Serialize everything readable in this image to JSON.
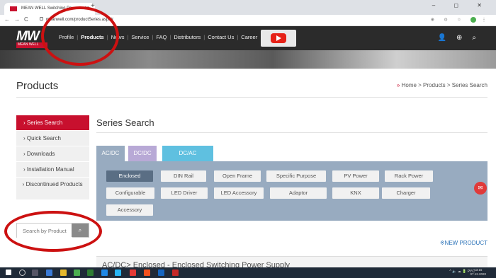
{
  "browser": {
    "tab_title": "MEAN WELL Switching Po...",
    "url": "meanwell.com/productSeries.aspx#",
    "win_controls": "–  ◻  ✕"
  },
  "site": {
    "logo_text": "MW",
    "logo_sub": "MEAN WELL",
    "menu": [
      "Profile",
      "Products",
      "News",
      "Service",
      "FAQ",
      "Distributors",
      "Contact Us",
      "Career"
    ]
  },
  "page": {
    "title": "Products",
    "breadcrumb": [
      "Home",
      "Products",
      "Series Search"
    ]
  },
  "sidebar": {
    "items": [
      "Series Search",
      "Quick Search",
      "Downloads",
      "Installation Manual",
      "Discontinued Products"
    ],
    "search_placeholder": "Search by Product"
  },
  "main": {
    "section_title": "Series Search",
    "tabs": [
      {
        "label": "AC/DC",
        "color": "#98abc0"
      },
      {
        "label": "DC/DC",
        "color": "#b8a9d6"
      },
      {
        "label": "DC/AC",
        "color": "#5fc0e0"
      }
    ],
    "categories": [
      "Enclosed",
      "DIN Rail",
      "Open Frame",
      "Specific Purpose",
      "PV Power",
      "Rack Power",
      "Configurable",
      "LED Driver",
      "LED Accessory",
      "Adaptor",
      "KNX",
      "Charger",
      "Accessory"
    ],
    "selected_category": "Enclosed",
    "new_product": "NEW PRODUCT",
    "results_heading": "AC/DC> Enclosed - Enclosed Switching Power Supply"
  },
  "taskbar": {
    "tray": "^ 🔈 ☁ 🔋 PYC",
    "time": "13:15",
    "date": "07.12.2020"
  },
  "colors": {
    "brand_red": "#c8102e",
    "nav_dark": "#2b2b2b",
    "panel": "#98abc0",
    "selected_chip": "#5a6e84"
  }
}
